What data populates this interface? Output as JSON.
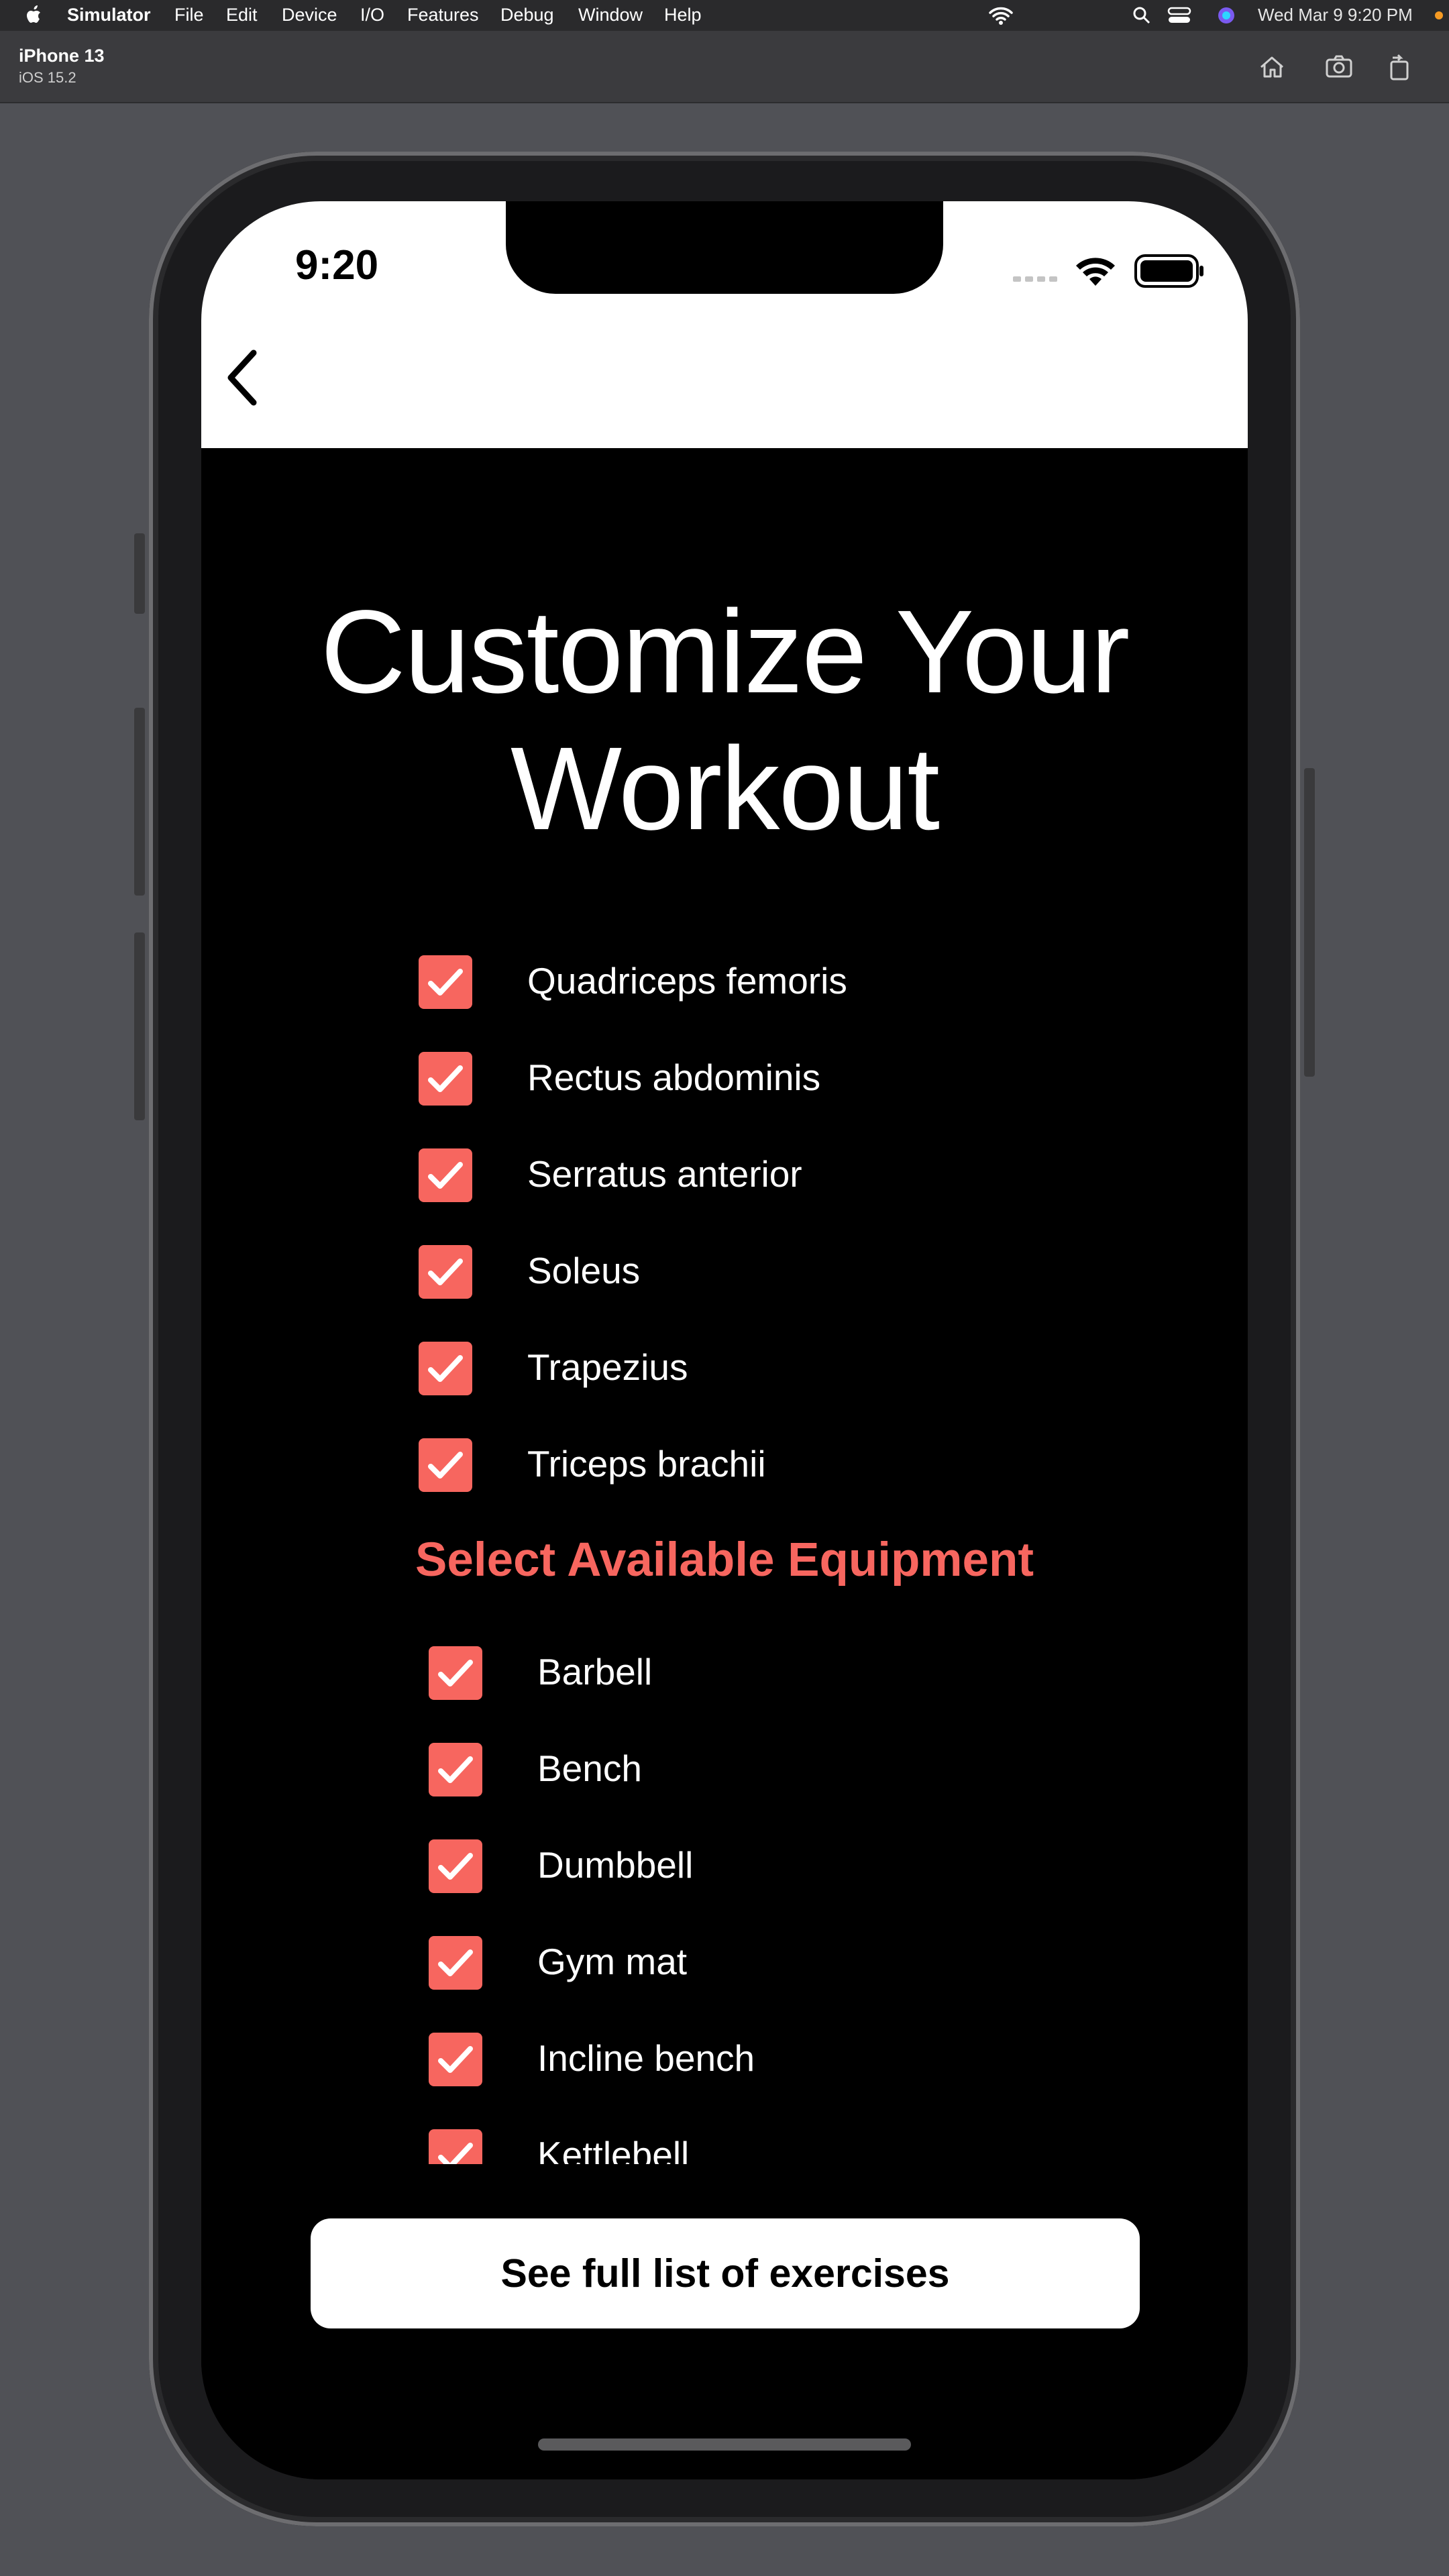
{
  "menubar": {
    "app": "Simulator",
    "items": [
      "File",
      "Edit",
      "Device",
      "I/O",
      "Features",
      "Debug",
      "Window",
      "Help"
    ],
    "datetime": "Wed Mar 9  9:20 PM"
  },
  "toolbar": {
    "device": "iPhone 13",
    "os": "iOS 15.2"
  },
  "status": {
    "time": "9:20"
  },
  "page": {
    "title_line1": "Customize Your",
    "title_line2": "Workout"
  },
  "muscles": [
    {
      "label": "Quadriceps femoris",
      "checked": true
    },
    {
      "label": "Rectus abdominis",
      "checked": true
    },
    {
      "label": "Serratus anterior",
      "checked": true
    },
    {
      "label": "Soleus",
      "checked": true
    },
    {
      "label": "Trapezius",
      "checked": true
    },
    {
      "label": "Triceps brachii",
      "checked": true
    }
  ],
  "equipment_heading": "Select Available Equipment",
  "equipment": [
    {
      "label": "Barbell",
      "checked": true
    },
    {
      "label": "Bench",
      "checked": true
    },
    {
      "label": "Dumbbell",
      "checked": true
    },
    {
      "label": "Gym mat",
      "checked": true
    },
    {
      "label": "Incline bench",
      "checked": true
    },
    {
      "label": "Kettlebell",
      "checked": true
    }
  ],
  "cta": {
    "label": "See full list of exercises"
  },
  "colors": {
    "accent": "#F7665F",
    "background": "#000000",
    "simulator_bg": "#505156"
  }
}
